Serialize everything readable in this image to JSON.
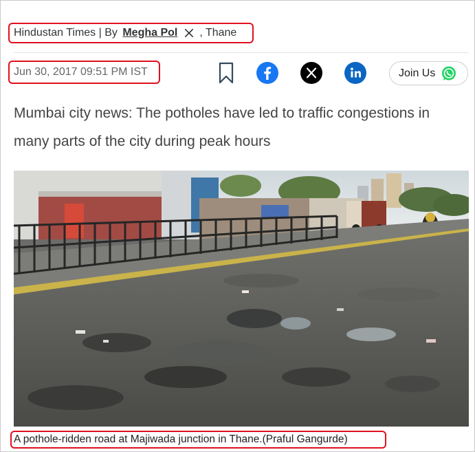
{
  "byline": {
    "publication": "Hindustan Times",
    "separator": " | By ",
    "author": "Megha Pol",
    "location": ", Thane",
    "author_social_icon": "x-icon"
  },
  "dateline": {
    "timestamp": "Jun 30, 2017 09:51 PM IST"
  },
  "share_bar": {
    "bookmark_icon": "bookmark-icon",
    "facebook_icon": "facebook-icon",
    "x_icon": "x-icon",
    "linkedin_icon": "linkedin-icon",
    "join_label": "Join Us",
    "whatsapp_icon": "whatsapp-icon",
    "colors": {
      "facebook": "#1877f2",
      "x": "#000000",
      "linkedin": "#0a66c2",
      "whatsapp": "#25d366"
    }
  },
  "article": {
    "headline": "Mumbai city news: The potholes have led to traffic congestions in many parts of the city during peak hours",
    "image_caption": "A pothole-ridden road at Majiwada junction in Thane.(Praful Gangurde)"
  },
  "highlight_color": "#e0101e"
}
